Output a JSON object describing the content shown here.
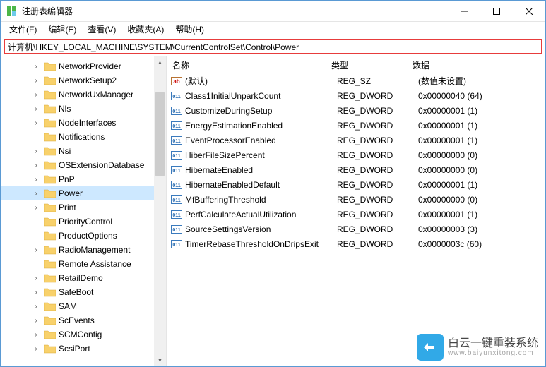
{
  "window": {
    "title": "注册表编辑器"
  },
  "menus": [
    "文件(F)",
    "编辑(E)",
    "查看(V)",
    "收藏夹(A)",
    "帮助(H)"
  ],
  "address": "计算机\\HKEY_LOCAL_MACHINE\\SYSTEM\\CurrentControlSet\\Control\\Power",
  "tree": [
    {
      "indent": 2,
      "exp": "›",
      "label": "NetworkProvider"
    },
    {
      "indent": 2,
      "exp": "›",
      "label": "NetworkSetup2"
    },
    {
      "indent": 2,
      "exp": "›",
      "label": "NetworkUxManager"
    },
    {
      "indent": 2,
      "exp": "›",
      "label": "Nls"
    },
    {
      "indent": 2,
      "exp": "›",
      "label": "NodeInterfaces"
    },
    {
      "indent": 2,
      "exp": "",
      "label": "Notifications"
    },
    {
      "indent": 2,
      "exp": "›",
      "label": "Nsi"
    },
    {
      "indent": 2,
      "exp": "›",
      "label": "OSExtensionDatabase"
    },
    {
      "indent": 2,
      "exp": "›",
      "label": "PnP"
    },
    {
      "indent": 2,
      "exp": "›",
      "label": "Power",
      "selected": true
    },
    {
      "indent": 2,
      "exp": "›",
      "label": "Print"
    },
    {
      "indent": 2,
      "exp": "",
      "label": "PriorityControl"
    },
    {
      "indent": 2,
      "exp": "",
      "label": "ProductOptions"
    },
    {
      "indent": 2,
      "exp": "›",
      "label": "RadioManagement"
    },
    {
      "indent": 2,
      "exp": "",
      "label": "Remote Assistance"
    },
    {
      "indent": 2,
      "exp": "›",
      "label": "RetailDemo"
    },
    {
      "indent": 2,
      "exp": "›",
      "label": "SafeBoot"
    },
    {
      "indent": 2,
      "exp": "›",
      "label": "SAM"
    },
    {
      "indent": 2,
      "exp": "›",
      "label": "ScEvents"
    },
    {
      "indent": 2,
      "exp": "›",
      "label": "SCMConfig"
    },
    {
      "indent": 2,
      "exp": "›",
      "label": "ScsiPort"
    }
  ],
  "columns": {
    "name": "名称",
    "type": "类型",
    "data": "数据"
  },
  "values": [
    {
      "icon": "sz",
      "name": "(默认)",
      "type": "REG_SZ",
      "data": "(数值未设置)"
    },
    {
      "icon": "dw",
      "name": "Class1InitialUnparkCount",
      "type": "REG_DWORD",
      "data": "0x00000040 (64)"
    },
    {
      "icon": "dw",
      "name": "CustomizeDuringSetup",
      "type": "REG_DWORD",
      "data": "0x00000001 (1)"
    },
    {
      "icon": "dw",
      "name": "EnergyEstimationEnabled",
      "type": "REG_DWORD",
      "data": "0x00000001 (1)"
    },
    {
      "icon": "dw",
      "name": "EventProcessorEnabled",
      "type": "REG_DWORD",
      "data": "0x00000001 (1)"
    },
    {
      "icon": "dw",
      "name": "HiberFileSizePercent",
      "type": "REG_DWORD",
      "data": "0x00000000 (0)"
    },
    {
      "icon": "dw",
      "name": "HibernateEnabled",
      "type": "REG_DWORD",
      "data": "0x00000000 (0)"
    },
    {
      "icon": "dw",
      "name": "HibernateEnabledDefault",
      "type": "REG_DWORD",
      "data": "0x00000001 (1)"
    },
    {
      "icon": "dw",
      "name": "MfBufferingThreshold",
      "type": "REG_DWORD",
      "data": "0x00000000 (0)"
    },
    {
      "icon": "dw",
      "name": "PerfCalculateActualUtilization",
      "type": "REG_DWORD",
      "data": "0x00000001 (1)"
    },
    {
      "icon": "dw",
      "name": "SourceSettingsVersion",
      "type": "REG_DWORD",
      "data": "0x00000003 (3)"
    },
    {
      "icon": "dw",
      "name": "TimerRebaseThresholdOnDripsExit",
      "type": "REG_DWORD",
      "data": "0x0000003c (60)"
    }
  ],
  "watermark": {
    "main": "白云一键重装系统",
    "sub": "www.baiyunxitong.com"
  }
}
